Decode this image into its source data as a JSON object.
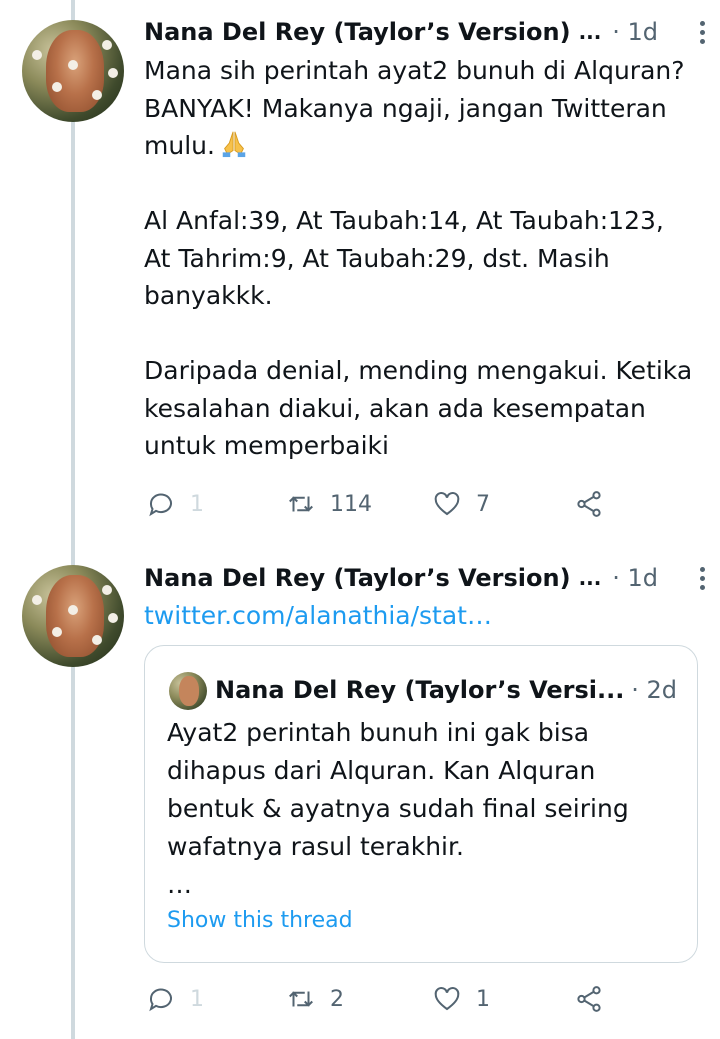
{
  "tweets": [
    {
      "author": "Nana Del Rey (Taylor’s Version)",
      "author_ellipsis": "...",
      "time": "· 1d",
      "lines": [
        "Mana sih perintah ayat2 bunuh di Alquran?",
        "BANYAK! Makanya ngaji, jangan Twitteran",
        "mulu.",
        "",
        "Al Anfal:39, At Taubah:14, At Taubah:123,",
        "At Tahrim:9, At Taubah:29, dst. Masih",
        "banyakkk.",
        "",
        "Daripada denial, mending mengakui. Ketika",
        "kesalahan diakui, akan ada kesempatan",
        "untuk memperbaiki"
      ],
      "emoji": "folded-hands",
      "actions": {
        "reply": "1",
        "retweet": "114",
        "like": "7"
      }
    },
    {
      "author": "Nana Del Rey (Taylor’s Version)",
      "author_ellipsis": "...",
      "time": "· 1d",
      "link": "twitter.com/alanathia/stat…",
      "quote": {
        "author": "Nana Del Rey (Taylor’s Versi...",
        "time": "· 2d",
        "lines": [
          "Ayat2 perintah bunuh ini gak bisa",
          "dihapus dari Alquran. Kan Alquran",
          "bentuk & ayatnya sudah final seiring",
          "wafatnya rasul terakhir.",
          "…"
        ],
        "show_thread": "Show this thread"
      },
      "actions": {
        "reply": "1",
        "retweet": "2",
        "like": "1"
      }
    }
  ],
  "colors": {
    "text": "#0f1419",
    "secondary": "#536471",
    "link": "#1d9bf0",
    "thread_line": "#cfd9de"
  }
}
